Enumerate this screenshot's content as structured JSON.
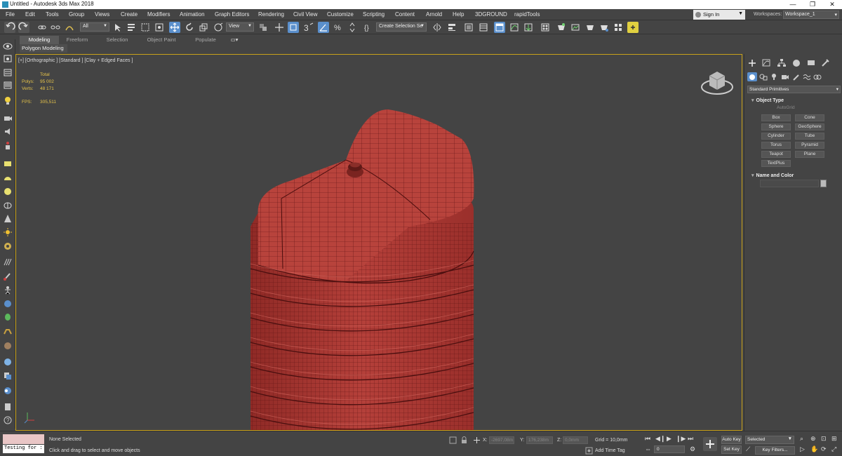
{
  "window": {
    "title": "Untitled - Autodesk 3ds Max 2018",
    "minimize": "—",
    "restore": "❐",
    "close": "✕"
  },
  "menu": [
    "File",
    "Edit",
    "Tools",
    "Group",
    "Views",
    "Create",
    "Modifiers",
    "Animation",
    "Graph Editors",
    "Rendering",
    "Civil View",
    "Customize",
    "Scripting",
    "Content",
    "Arnold",
    "Help",
    "3DGROUND",
    "rapidTools"
  ],
  "account": {
    "sign_in": "Sign In",
    "workspaces_label": "Workspaces:",
    "workspace": "Workspace_1"
  },
  "toolbar": {
    "filter": "All",
    "ref_coord": "View",
    "selection_set": "Create Selection Se"
  },
  "ribbon": {
    "tabs": [
      "Modeling",
      "Freeform",
      "Selection",
      "Object Paint",
      "Populate"
    ],
    "active_tab": "Modeling",
    "sub": "Polygon Modeling"
  },
  "viewport": {
    "label": "[+] [Orthographic ] [Standard ] [Clay + Edged Faces ]",
    "stats": {
      "total_label": "Total",
      "polys_label": "Polys:",
      "polys": "95 002",
      "verts_label": "Verts:",
      "verts": "48 171",
      "fps_label": "FPS:",
      "fps": "305,511"
    },
    "model_color": "#b23a35"
  },
  "command_panel": {
    "category": "Standard Primitives",
    "object_type": {
      "title": "Object Type",
      "autogrid": "AutoGrid",
      "buttons": [
        "Box",
        "Cone",
        "Sphere",
        "GeoSphere",
        "Cylinder",
        "Tube",
        "Torus",
        "Pyramid",
        "Teapot",
        "Plane",
        "TextPlus"
      ]
    },
    "name_color": {
      "title": "Name and Color"
    }
  },
  "status": {
    "maxscript_output": "Testing for :",
    "selection": "None Selected",
    "prompt": "Click and drag to select and move objects",
    "x_label": "X:",
    "x": "-2697,08m",
    "y_label": "Y:",
    "y": "176,238m",
    "z_label": "Z:",
    "z": "0,0mm",
    "grid": "Grid = 10,0mm",
    "add_time_tag": "Add Time Tag",
    "frame": "0",
    "auto_key": "Auto Key",
    "set_key": "Set Key",
    "key_mode": "Selected",
    "key_filters": "Key Filters..."
  }
}
